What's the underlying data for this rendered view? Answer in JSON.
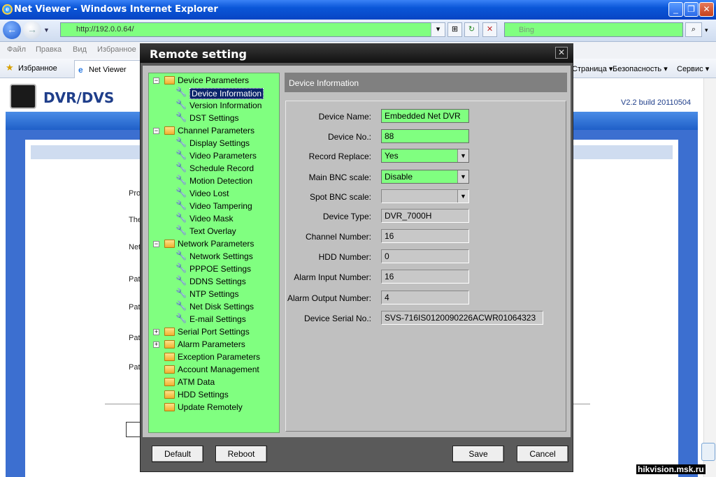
{
  "browser": {
    "title": "Net Viewer - Windows Internet Explorer",
    "url": "http://192.0.0.64/",
    "search_placeholder": "Bing",
    "menu": [
      "Файл",
      "Правка",
      "Вид",
      "Избранное"
    ],
    "favorites_label": "Избранное",
    "tab_label": "Net Viewer",
    "toolbar_right": [
      "Страница ▾",
      "Безопасность ▾",
      "Сервис ▾"
    ]
  },
  "page": {
    "app_title": "DVR/DVS",
    "version": "V2.2  build 20110504",
    "side_labels": [
      "Pro",
      "The",
      "Net",
      "Pat",
      "Pat",
      "Pat",
      "Pat"
    ]
  },
  "dialog": {
    "title": "Remote setting",
    "close": "✕",
    "tree": [
      {
        "label": "Device Parameters",
        "level": 0,
        "type": "folder",
        "expander": "−"
      },
      {
        "label": "Device Information",
        "level": 1,
        "type": "leaf",
        "selected": true
      },
      {
        "label": "Version Information",
        "level": 1,
        "type": "leaf"
      },
      {
        "label": "DST Settings",
        "level": 1,
        "type": "leaf"
      },
      {
        "label": "Channel Parameters",
        "level": 0,
        "type": "folder",
        "expander": "−"
      },
      {
        "label": "Display Settings",
        "level": 1,
        "type": "leaf"
      },
      {
        "label": "Video Parameters",
        "level": 1,
        "type": "leaf"
      },
      {
        "label": "Schedule Record",
        "level": 1,
        "type": "leaf"
      },
      {
        "label": "Motion Detection",
        "level": 1,
        "type": "leaf"
      },
      {
        "label": "Video Lost",
        "level": 1,
        "type": "leaf"
      },
      {
        "label": "Video Tampering",
        "level": 1,
        "type": "leaf"
      },
      {
        "label": "Video Mask",
        "level": 1,
        "type": "leaf"
      },
      {
        "label": "Text Overlay",
        "level": 1,
        "type": "leaf"
      },
      {
        "label": "Network Parameters",
        "level": 0,
        "type": "folder",
        "expander": "−"
      },
      {
        "label": "Network Settings",
        "level": 1,
        "type": "leaf"
      },
      {
        "label": "PPPOE Settings",
        "level": 1,
        "type": "leaf"
      },
      {
        "label": "DDNS Settings",
        "level": 1,
        "type": "leaf"
      },
      {
        "label": "NTP Settings",
        "level": 1,
        "type": "leaf"
      },
      {
        "label": "Net Disk Settings",
        "level": 1,
        "type": "leaf"
      },
      {
        "label": "E-mail Settings",
        "level": 1,
        "type": "leaf"
      },
      {
        "label": "Serial Port Settings",
        "level": 0,
        "type": "folder",
        "expander": "+"
      },
      {
        "label": "Alarm Parameters",
        "level": 0,
        "type": "folder",
        "expander": "+"
      },
      {
        "label": "Exception Parameters",
        "level": 0,
        "type": "folder",
        "expander": ""
      },
      {
        "label": "Account Management",
        "level": 0,
        "type": "folder",
        "expander": ""
      },
      {
        "label": "ATM Data",
        "level": 0,
        "type": "folder",
        "expander": ""
      },
      {
        "label": "HDD Settings",
        "level": 0,
        "type": "folder",
        "expander": ""
      },
      {
        "label": "Update Remotely",
        "level": 0,
        "type": "folder",
        "expander": ""
      }
    ],
    "panel_title": "Device Information",
    "fields": [
      {
        "label": "Device Name:",
        "value": "Embedded Net DVR",
        "style": "green",
        "dropdown": false
      },
      {
        "label": "Device No.:",
        "value": "88",
        "style": "green",
        "dropdown": false
      },
      {
        "label": "Record Replace:",
        "value": "Yes",
        "style": "green",
        "dropdown": true
      },
      {
        "label": "Main BNC scale:",
        "value": "Disable",
        "style": "green",
        "dropdown": true
      },
      {
        "label": "Spot BNC scale:",
        "value": "",
        "style": "gray",
        "dropdown": true
      },
      {
        "label": "Device Type:",
        "value": "DVR_7000H",
        "style": "gray",
        "dropdown": false
      },
      {
        "label": "Channel Number:",
        "value": "16",
        "style": "gray",
        "dropdown": false
      },
      {
        "label": "HDD Number:",
        "value": "0",
        "style": "gray",
        "dropdown": false
      },
      {
        "label": "Alarm Input Number:",
        "value": "16",
        "style": "gray",
        "dropdown": false
      },
      {
        "label": "Alarm Output Number:",
        "value": "4",
        "style": "gray",
        "dropdown": false
      },
      {
        "label": "Device Serial No.:",
        "value": "SVS-716IS0120090226ACWR01064323",
        "style": "gray",
        "dropdown": false
      }
    ],
    "buttons": {
      "default": "Default",
      "reboot": "Reboot",
      "save": "Save",
      "cancel": "Cancel"
    }
  },
  "watermark": "hikvision.msk.ru"
}
